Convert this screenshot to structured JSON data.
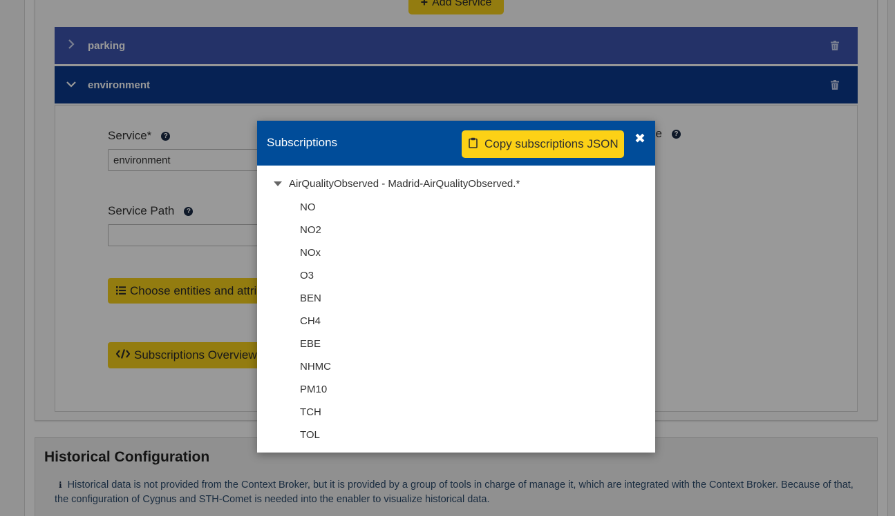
{
  "toolbar": {
    "add_service_label": "Add Service"
  },
  "accordion": [
    {
      "label": "parking",
      "expanded": false
    },
    {
      "label": "environment",
      "expanded": true
    }
  ],
  "form": {
    "service_label": "Service*",
    "service_value": "environment",
    "service_path_label": "Service Path",
    "service_path_value": "",
    "partial_right_label": "se",
    "choose_entities_label": "Choose entities and attri",
    "subscriptions_overview_label": "Subscriptions Overview"
  },
  "history": {
    "title": "Historical Configuration",
    "text": "Historical data is not provided from the Context Broker, but it is provided by a group of tools in charge of manage it, which are integrated with the Context Broker. Because of that, the configuration of Cygnus and STH-Comet is needed into the enabler to visualize historical data."
  },
  "modal": {
    "title": "Subscriptions",
    "copy_label": "Copy subscriptions JSON",
    "close_glyph": "✖",
    "tree": {
      "root_label": "AirQualityObserved - Madrid-AirQualityObserved.*",
      "attributes": [
        "NO",
        "NO2",
        "NOx",
        "O3",
        "BEN",
        "CH4",
        "EBE",
        "NHMC",
        "PM10",
        "TCH",
        "TOL"
      ]
    }
  },
  "colors": {
    "accent_yellow": "#f6cf1c",
    "parking_row": "#3d54ad",
    "environment_row": "#0a3a8c",
    "modal_header": "#004c99"
  },
  "icons": [
    "plus-icon",
    "chevron-right-icon",
    "chevron-down-icon",
    "trash-icon",
    "help-icon",
    "list-icon",
    "code-icon",
    "clipboard-icon",
    "close-icon",
    "caret-down-icon",
    "info-icon"
  ]
}
